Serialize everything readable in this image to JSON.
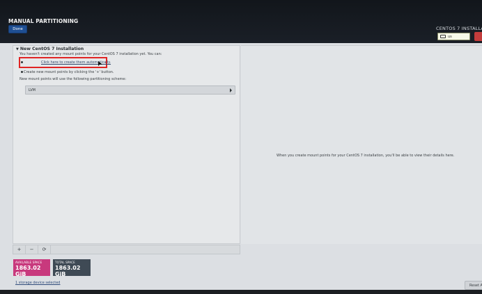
{
  "header": {
    "title": "MANUAL PARTITIONING",
    "done_label": "Done",
    "product_title": "CENTOS 7 INSTALLA",
    "keyboard_layout": "us",
    "keyboard_icon": "keyboard-icon"
  },
  "left_panel": {
    "section_title": "New CentOS 7 Installation",
    "intro": "You haven't created any mount points for your CentOS 7 installation yet.  You can:",
    "auto_link": "Click here to create them automatically.",
    "create_hint": "Create new mount points by clicking the '+' button.",
    "scheme_label": "New mount points will use the following partitioning scheme:",
    "scheme_value": "LVM"
  },
  "toolbar": {
    "add": "+",
    "remove": "−",
    "refresh": "⟳"
  },
  "space": {
    "available_label": "AVAILABLE SPACE",
    "available_value": "1863.02 GiB",
    "total_label": "TOTAL SPACE",
    "total_value": "1863.02 GiB"
  },
  "storage_link": "1 storage device selected",
  "right_panel": {
    "message": "When you create mount points for your CentOS 7 installation, you'll be able to view their details here."
  },
  "reset_label": "Reset A",
  "colors": {
    "available": "#c8397d",
    "total": "#3f4a55",
    "done_button": "#1f4f93",
    "highlight": "#e02424"
  }
}
